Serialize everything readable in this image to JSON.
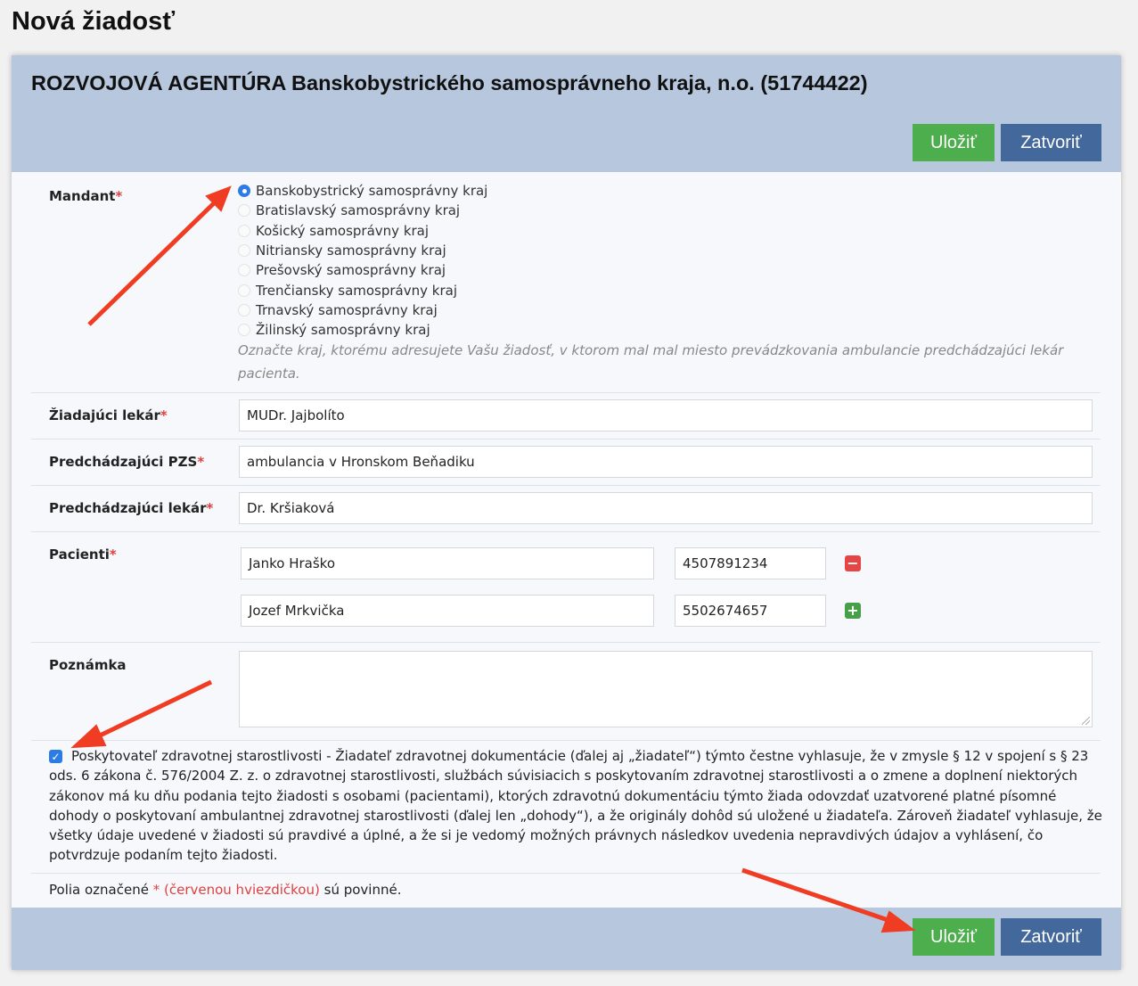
{
  "page_title": "Nová žiadosť",
  "org_title": "ROZVOJOVÁ AGENTÚRA Banskobystrického samosprávneho kraja, n.o. (51744422)",
  "buttons": {
    "save": "Uložiť",
    "close": "Zatvoriť"
  },
  "required_marker": "*",
  "mandant": {
    "label": "Mandant",
    "options": [
      "Banskobystrický samosprávny kraj",
      "Bratislavský samosprávny kraj",
      "Košický samosprávny kraj",
      "Nitriansky samosprávny kraj",
      "Prešovský samosprávny kraj",
      "Trenčiansky samosprávny kraj",
      "Trnavský samosprávny kraj",
      "Žilinský samosprávny kraj"
    ],
    "selected": "Banskobystrický samosprávny kraj",
    "hint": "Označte kraj, ktorému adresujete Vašu žiadosť, v ktorom mal mal miesto prevádzkovania ambulancie predchádzajúci lekár pacienta."
  },
  "fields": {
    "requesting_doctor": {
      "label": "Žiadajúci lekár",
      "value": "MUDr. Jajbolíto"
    },
    "previous_pzs": {
      "label": "Predchádzajúci PZS",
      "value": "ambulancia v Hronskom Beňadiku"
    },
    "previous_doctor": {
      "label": "Predchádzajúci lekár",
      "value": "Dr. Kršiaková"
    }
  },
  "patients": {
    "label": "Pacienti",
    "rows": [
      {
        "name": "Janko Hraško",
        "id": "4507891234",
        "action": "remove-icon"
      },
      {
        "name": "Jozef Mrkvička",
        "id": "5502674657",
        "action": "add-icon"
      }
    ]
  },
  "note": {
    "label": "Poznámka",
    "value": ""
  },
  "declaration": {
    "checked": true,
    "text": "Poskytovateľ zdravotnej starostlivosti - Žiadateľ zdravotnej dokumentácie (ďalej aj „žiadateľ“) týmto čestne vyhlasuje, že v zmysle § 12 v spojení s § 23 ods. 6 zákona č. 576/2004 Z. z. o zdravotnej starostlivosti, službách súvisiacich s poskytovaním zdravotnej starostlivosti a o zmene a doplnení niektorých zákonov má ku dňu podania tejto žiadosti s osobami (pacientami), ktorých zdravotnú dokumentáciu týmto žiada odovzdať uzatvorené platné písomné dohody o poskytovaní ambulantnej zdravotnej starostlivosti (ďalej len „dohody“), a že originály dohôd sú uložené u žiadateľa. Zároveň žiadateľ vyhlasuje, že všetky údaje uvedené v žiadosti sú pravdivé a úplné, a že si je vedomý možných právnych následkov uvedenia nepravdivých údajov a vyhlásení, čo potvrdzuje podaním tejto žiadosti."
  },
  "required_note": {
    "prefix": "Polia označené",
    "marker": "* (červenou hviezdičkou)",
    "suffix": "sú povinné."
  },
  "colors": {
    "header_bg": "#b7c8de",
    "save_green": "#4cae4c",
    "close_blue": "#43699c",
    "required_red": "#e04040",
    "annotation_arrow": "#f03c22"
  }
}
